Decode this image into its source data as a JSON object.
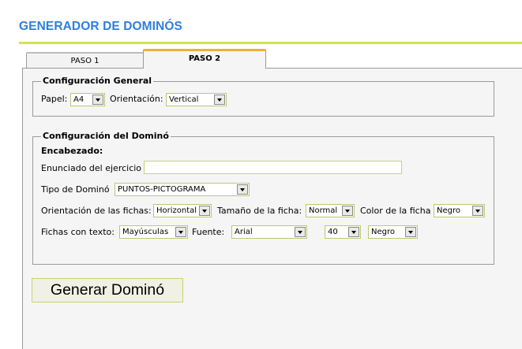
{
  "header": {
    "title": "GENERADOR DE DOMINÓS"
  },
  "tabs": [
    {
      "label": "PASO 1",
      "active": false
    },
    {
      "label": "PASO 2",
      "active": true
    }
  ],
  "general": {
    "legend": "Configuración General",
    "paper_label": "Papel:",
    "paper_value": "A4",
    "orientation_label": "Orientación:",
    "orientation_value": "Vertical"
  },
  "domino": {
    "legend": "Configuración del Dominó",
    "heading_label": "Encabezado:",
    "statement_label": "Enunciado del ejercicio",
    "statement_value": "",
    "type_label": "Tipo de Dominó",
    "type_value": "PUNTOS-PICTOGRAMA",
    "tile_orientation_label": "Orientación de las fichas:",
    "tile_orientation_value": "Horizontal",
    "tile_size_label": "Tamaño de la ficha:",
    "tile_size_value": "Normal",
    "tile_color_label": "Color de la ficha",
    "tile_color_value": "Negro",
    "text_tiles_label": "Fichas con texto:",
    "text_tiles_value": "Mayúsculas",
    "font_label": "Fuente:",
    "font_value": "Arial",
    "font_size_value": "40",
    "font_color_value": "Negro"
  },
  "actions": {
    "generate_label": "Generar Dominó"
  },
  "colors": {
    "title": "#2e7fd9",
    "title_rule": "#d2e25a",
    "active_tab_accent": "#f0b033",
    "panel_background": "#f5f5f5",
    "field_border": "#bcc86e"
  }
}
